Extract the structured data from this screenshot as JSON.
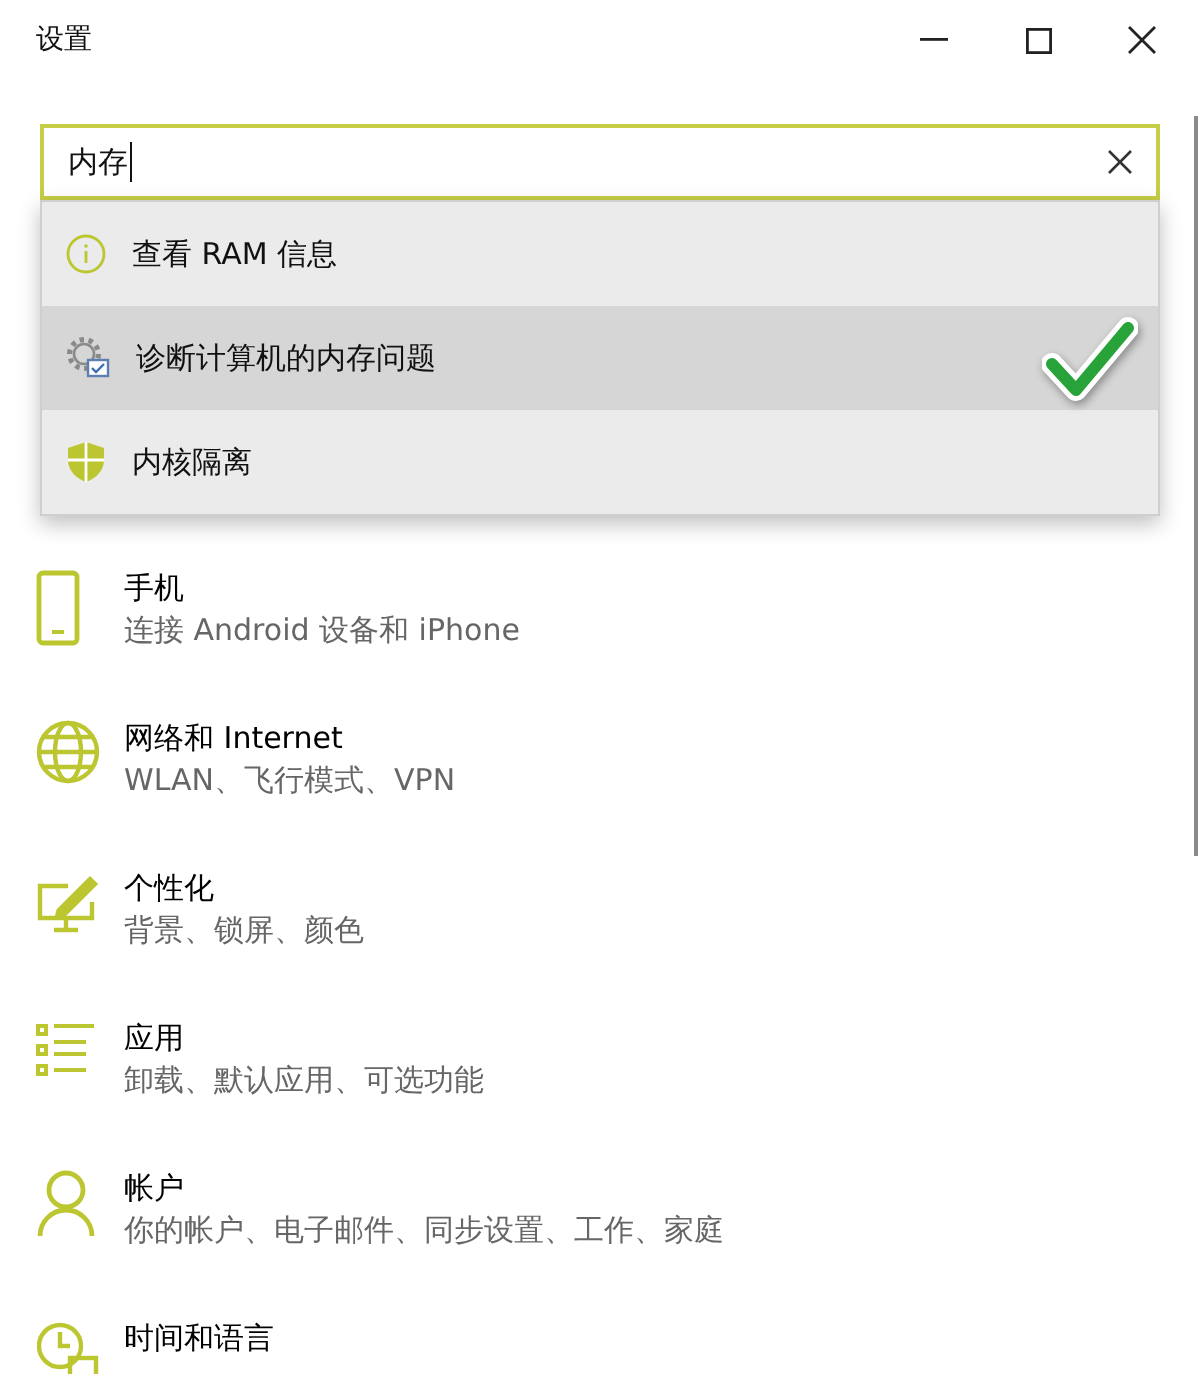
{
  "window": {
    "title": "设置"
  },
  "search": {
    "value": "内存",
    "focused": true
  },
  "results": [
    {
      "kind": "info",
      "label": "查看 RAM 信息",
      "selected": false,
      "checked": false
    },
    {
      "kind": "diagnose",
      "label": "诊断计算机的内存问题",
      "selected": true,
      "checked": true
    },
    {
      "kind": "shield",
      "label": "内核隔离",
      "selected": false,
      "checked": false
    }
  ],
  "categories": [
    {
      "kind": "phone",
      "title": "手机",
      "description": "连接 Android 设备和 iPhone"
    },
    {
      "kind": "network",
      "title": "网络和 Internet",
      "description": "WLAN、飞行模式、VPN"
    },
    {
      "kind": "personalization",
      "title": "个性化",
      "description": "背景、锁屏、颜色"
    },
    {
      "kind": "apps",
      "title": "应用",
      "description": "卸载、默认应用、可选功能"
    },
    {
      "kind": "account",
      "title": "帐户",
      "description": "你的帐户、电子邮件、同步设置、工作、家庭"
    },
    {
      "kind": "time",
      "title": "时间和语言"
    }
  ]
}
